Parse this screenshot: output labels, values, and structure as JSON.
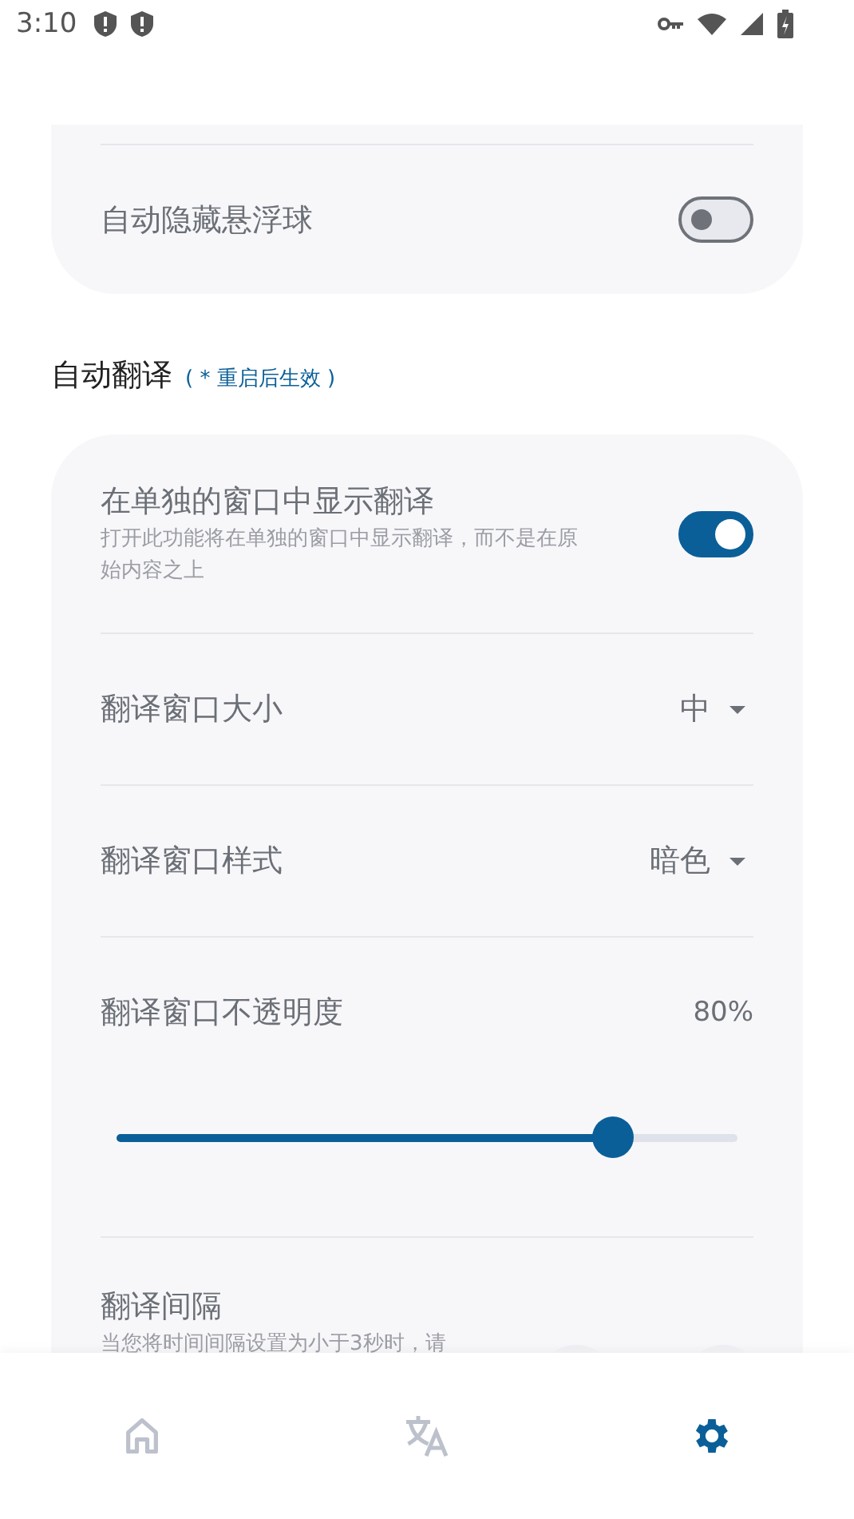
{
  "status_bar": {
    "time": "3:10"
  },
  "top_card": {
    "rows": [
      {
        "kind": "toggle",
        "title": "自动隐藏悬浮球",
        "on": false
      }
    ]
  },
  "section": {
    "title": "自动翻译",
    "note": "( * 重启后生效 )"
  },
  "settings": [
    {
      "kind": "toggle",
      "title": "在单独的窗口中显示翻译",
      "description": "打开此功能将在单独的窗口中显示翻译，而不是在原始内容之上",
      "on": true
    },
    {
      "kind": "dropdown",
      "title": "翻译窗口大小",
      "value": "中"
    },
    {
      "kind": "dropdown",
      "title": "翻译窗口样式",
      "value": "暗色"
    },
    {
      "kind": "slider",
      "title": "翻译窗口不透明度",
      "reading": "80%",
      "level": 0.8
    },
    {
      "kind": "stepper",
      "title": "翻译间隔",
      "description": "当您将时间间隔设置为小于3秒时，请"
    }
  ],
  "bottom_nav": {
    "items": [
      {
        "kind": "home",
        "selected": false
      },
      {
        "kind": "translate",
        "selected": false
      },
      {
        "kind": "settings",
        "selected": true
      }
    ]
  }
}
